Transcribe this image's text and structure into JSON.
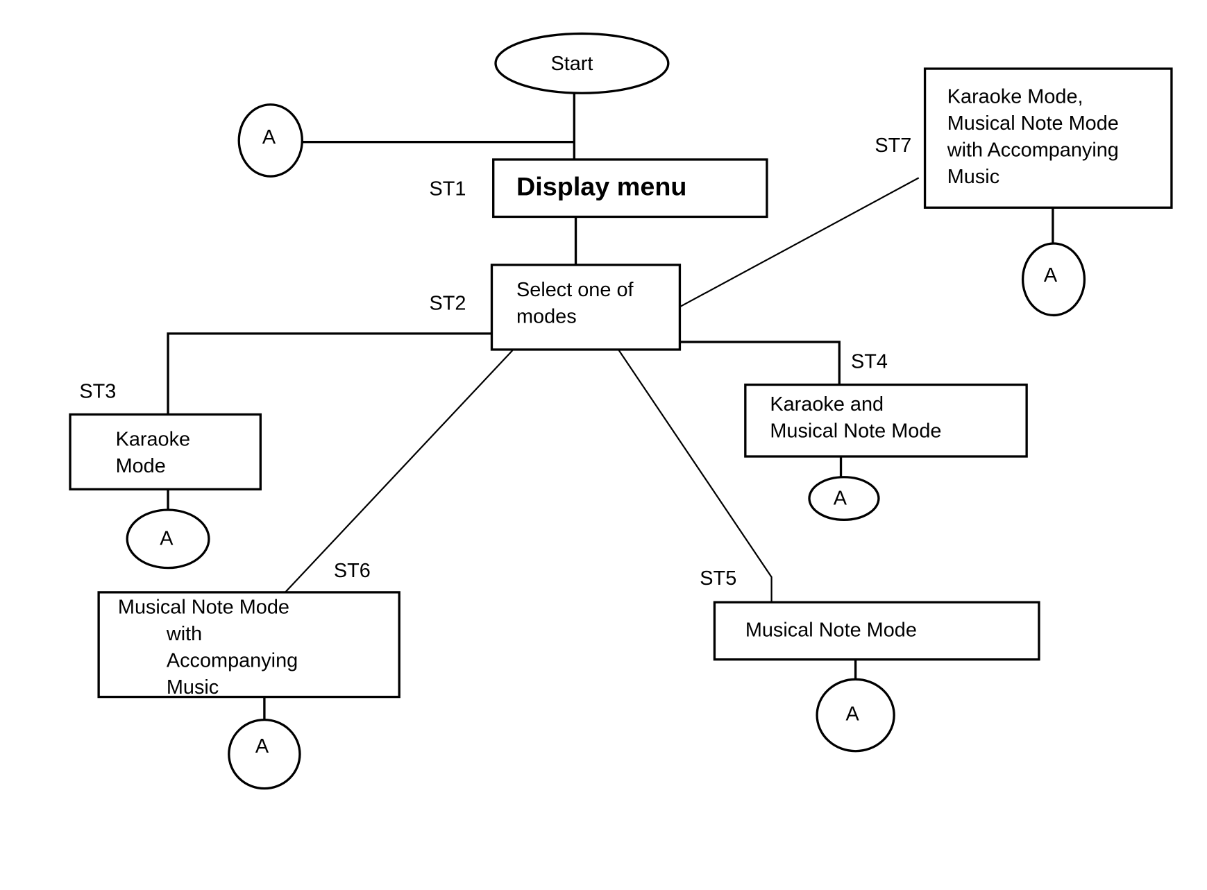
{
  "diagram": {
    "type": "flowchart",
    "start": "Start",
    "connector_label": "A",
    "steps": [
      {
        "id": "ST1",
        "label": "ST1",
        "lines": [
          "Display menu"
        ]
      },
      {
        "id": "ST2",
        "label": "ST2",
        "lines": [
          "Select one of",
          "modes"
        ]
      },
      {
        "id": "ST3",
        "label": "ST3",
        "lines": [
          "Karaoke",
          "Mode"
        ]
      },
      {
        "id": "ST4",
        "label": "ST4",
        "lines": [
          "Karaoke and",
          "Musical Note Mode"
        ]
      },
      {
        "id": "ST5",
        "label": "ST5",
        "lines": [
          "Musical Note Mode"
        ]
      },
      {
        "id": "ST6",
        "label": "ST6",
        "lines": [
          "Musical Note Mode",
          "with",
          "Accompanying",
          "Music"
        ]
      },
      {
        "id": "ST7",
        "label": "ST7",
        "lines": [
          "Karaoke Mode,",
          "Musical Note Mode",
          "with Accompanying",
          "Music"
        ]
      }
    ],
    "edges": [
      [
        "Start",
        "ST1"
      ],
      [
        "A",
        "ST1"
      ],
      [
        "ST1",
        "ST2"
      ],
      [
        "ST2",
        "ST3"
      ],
      [
        "ST2",
        "ST4"
      ],
      [
        "ST2",
        "ST5"
      ],
      [
        "ST2",
        "ST6"
      ],
      [
        "ST2",
        "ST7"
      ],
      [
        "ST3",
        "A"
      ],
      [
        "ST4",
        "A"
      ],
      [
        "ST5",
        "A"
      ],
      [
        "ST6",
        "A"
      ],
      [
        "ST7",
        "A"
      ]
    ]
  }
}
